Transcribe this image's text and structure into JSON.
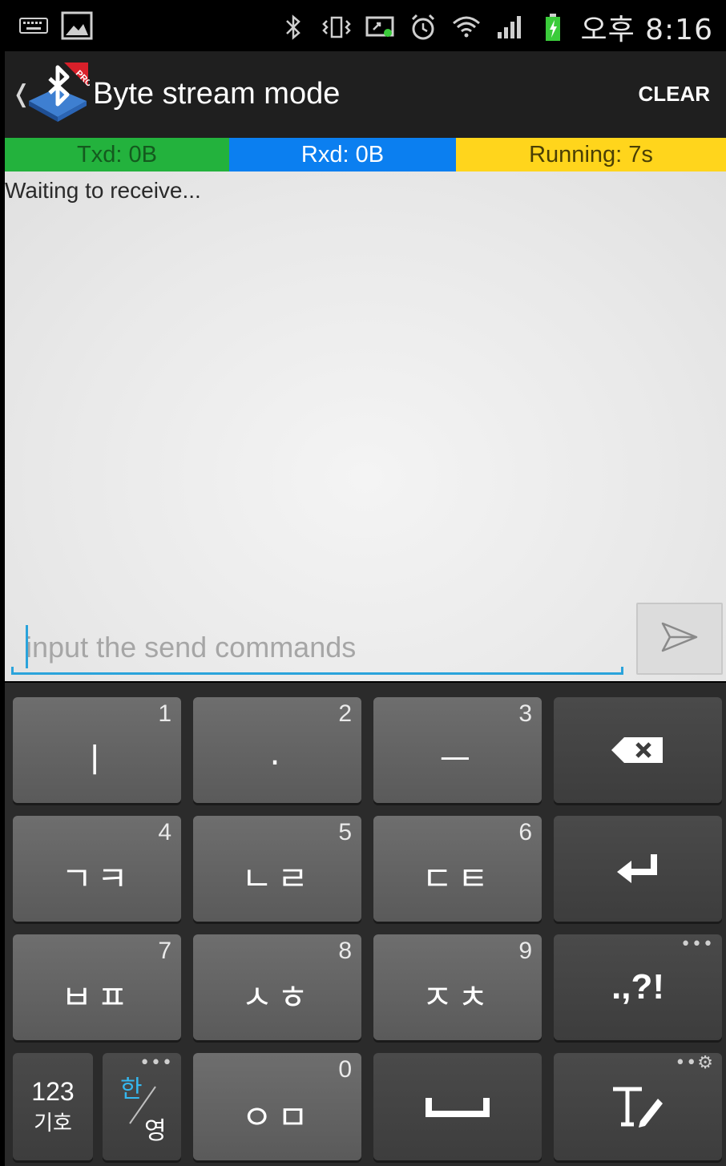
{
  "status_bar": {
    "time": "오후 8:16",
    "left_icons": [
      "keyboard-icon",
      "image-icon"
    ],
    "right_icons": [
      "bluetooth-icon",
      "vibrate-icon",
      "screen-share-icon",
      "alarm-icon",
      "wifi-icon",
      "signal-icon",
      "battery-icon"
    ],
    "colors": {
      "battery": "#3bcc3b"
    }
  },
  "action_bar": {
    "title": "Byte stream mode",
    "clear_label": "CLEAR",
    "logo_badge": "PRO"
  },
  "stats": {
    "txd": "Txd: 0B",
    "rxd": "Rxd: 0B",
    "running": "Running: 7s",
    "colors": {
      "txd": "#23b23d",
      "rxd": "#0b7ff0",
      "running": "#ffd51c"
    }
  },
  "content": {
    "received_text": "Waiting to receive..."
  },
  "input": {
    "placeholder": "input the send commands",
    "value": "",
    "accent": "#2aa3db"
  },
  "keyboard": {
    "row1": [
      {
        "num": "1",
        "main": "ㅣ"
      },
      {
        "num": "2",
        "main": "·"
      },
      {
        "num": "3",
        "main": "ㅡ"
      }
    ],
    "row2": [
      {
        "num": "4",
        "main": "ㄱㅋ"
      },
      {
        "num": "5",
        "main": "ㄴㄹ"
      },
      {
        "num": "6",
        "main": "ㄷㅌ"
      }
    ],
    "row3": [
      {
        "num": "7",
        "main": "ㅂㅍ"
      },
      {
        "num": "8",
        "main": "ㅅㅎ"
      },
      {
        "num": "9",
        "main": "ㅈㅊ"
      }
    ],
    "punct": ".,?!",
    "mode_top": "123",
    "mode_bottom": "기호",
    "lang_top": "한",
    "lang_bottom": "영",
    "zero_num": "0",
    "zero_main": "ㅇㅁ",
    "lang_accent": "#35b8f0"
  }
}
